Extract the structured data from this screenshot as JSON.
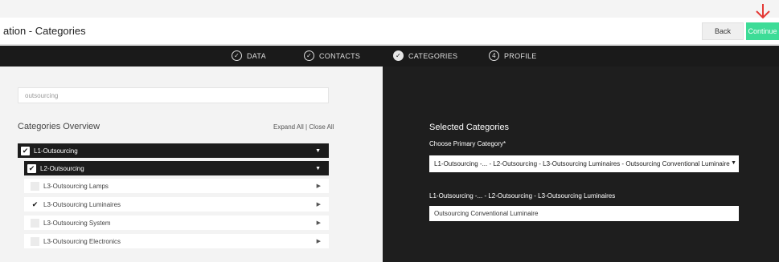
{
  "header": {
    "title": "ation - Categories",
    "back_label": "Back",
    "continue_label": "Continue"
  },
  "steps": [
    {
      "label": "DATA",
      "icon": "check-circle-icon",
      "state": "done"
    },
    {
      "label": "CONTACTS",
      "icon": "check-circle-icon",
      "state": "done"
    },
    {
      "label": "CATEGORIES",
      "icon": "check-circle-filled-icon",
      "state": "active"
    },
    {
      "label": "PROFILE",
      "number": "4",
      "state": "todo"
    }
  ],
  "left": {
    "search_value": "outsourcing",
    "overview_title": "Categories Overview",
    "expand_all": "Expand All",
    "separator": " | ",
    "close_all": "Close All",
    "tree": {
      "l1": {
        "label": "L1-Outsourcing",
        "checked": true
      },
      "l2": {
        "label": "L2-Outsourcing",
        "checked": true
      },
      "l3": [
        {
          "label": "L3-Outsourcing Lamps",
          "checked": false
        },
        {
          "label": "L3-Outsourcing Luminaires",
          "checked": true
        },
        {
          "label": "L3-Outsourcing System",
          "checked": false
        },
        {
          "label": "L3-Outsourcing Electronics",
          "checked": false
        }
      ]
    }
  },
  "right": {
    "title": "Selected Categories",
    "choose_label": "Choose Primary Category*",
    "primary_value": "L1-Outsourcing -... - L2-Outsourcing - L3-Outsourcing Luminaires - Outsourcing Conventional Luminaire",
    "path_label": "L1-Outsourcing -... - L2-Outsourcing - L3-Outsourcing Luminaires",
    "selected_value": "Outsourcing Conventional Luminaire"
  },
  "colors": {
    "accent_green": "#3ddc97",
    "dark_bg": "#1e1e1e",
    "annotation_red": "#e53935"
  }
}
